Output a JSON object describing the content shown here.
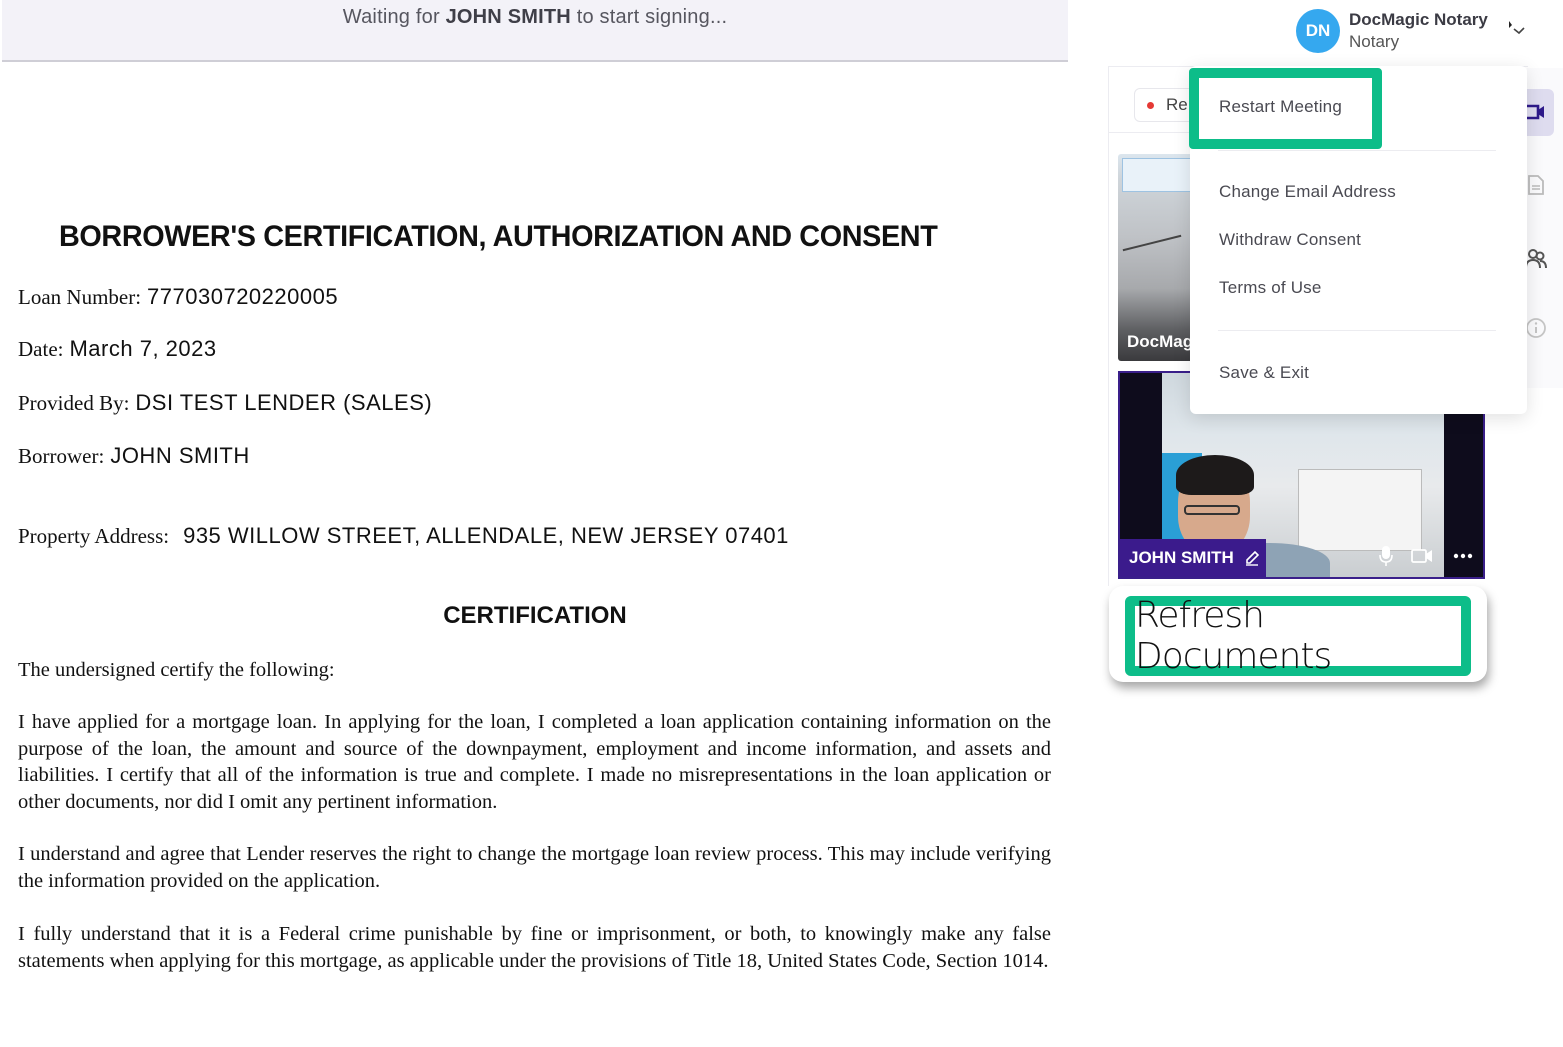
{
  "status": {
    "prefix": "Waiting for",
    "name": "JOHN SMITH",
    "suffix": "to start signing..."
  },
  "user": {
    "initials": "DN",
    "name": "DocMagic Notary",
    "role": "Notary",
    "avatar_color": "#35a8ef"
  },
  "document": {
    "title": "BORROWER'S CERTIFICATION, AUTHORIZATION AND CONSENT",
    "fields": [
      {
        "label": "Loan Number:",
        "value": "777030720220005"
      },
      {
        "label": "Date:",
        "value": "March 7, 2023"
      },
      {
        "label": "Provided By:",
        "value": "DSI TEST LENDER (SALES)"
      },
      {
        "label": "Borrower:",
        "value": "JOHN SMITH"
      },
      {
        "label": "Property Address:",
        "value": "935 WILLOW STREET, ALLENDALE, NEW JERSEY 07401"
      }
    ],
    "section_heading": "CERTIFICATION",
    "paragraphs": [
      "The undersigned certify the following:",
      "I have applied for a mortgage loan. In applying for the loan, I completed a loan application containing information on the purpose of the loan, the amount and source of the downpayment, employment and income information, and assets and liabilities. I certify that all of the information is true and complete. I made no misrepresentations in the loan application or other documents, nor did I omit any pertinent information.",
      "I understand and agree that Lender reserves the right to change the mortgage loan review process. This may include verifying the information provided on the application.",
      "I fully understand that it is a Federal crime punishable by fine or imprisonment, or both, to knowingly make any false statements when applying for this mortgage, as applicable under the provisions of Title 18, United States Code, Section 1014."
    ]
  },
  "meeting": {
    "record_label": "Re",
    "tiles": [
      {
        "name": "DocMag",
        "role": "notary"
      },
      {
        "name": "JOHN SMITH",
        "role": "borrower"
      }
    ],
    "tile_name_color": "#3b1b8c",
    "refresh_label": "Refresh Documents"
  },
  "menu": {
    "items": [
      {
        "label": "Restart Meeting"
      },
      {
        "label": "Change Email Address"
      },
      {
        "label": "Withdraw Consent"
      },
      {
        "label": "Terms of Use"
      },
      {
        "label": "Save & Exit"
      }
    ]
  },
  "rail": {
    "icons": [
      "video-icon",
      "document-icon",
      "participants-icon",
      "info-icon"
    ]
  },
  "colors": {
    "highlight": "#0dbd89",
    "recording": "#e53935",
    "accent": "#3b1b8c"
  }
}
